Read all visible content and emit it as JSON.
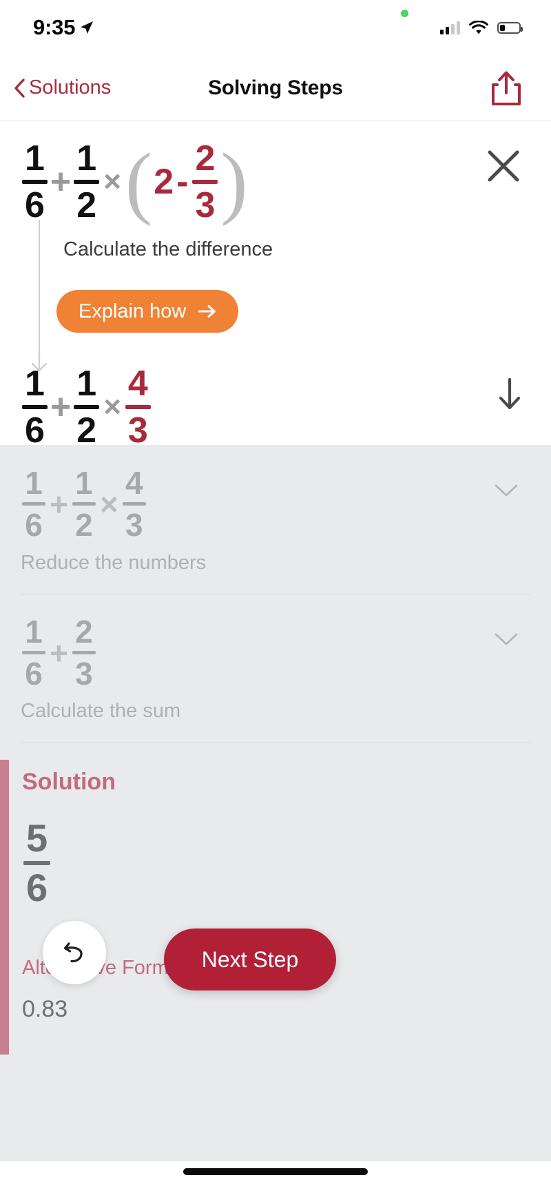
{
  "statusbar": {
    "time": "9:35",
    "location_icon": "location-arrow-icon",
    "cellular_icon": "cellular-signal-icon",
    "cellular_bars_filled": 2,
    "wifi_icon": "wifi-icon",
    "battery_icon": "battery-icon",
    "battery_percent": 25,
    "recording_dot": "green-privacy-dot"
  },
  "navbar": {
    "back_label": "Solutions",
    "back_icon": "chevron-left-icon",
    "title": "Solving Steps",
    "share_icon": "share-icon"
  },
  "active_step": {
    "close_icon": "close-icon",
    "down_icon": "arrow-down-icon",
    "guide_arrow_icon": "arrow-down-guide-icon",
    "hint": "Calculate the difference",
    "explain_label": "Explain how",
    "explain_arrow_icon": "arrow-right-icon",
    "expression": {
      "f1": {
        "num": "1",
        "den": "6"
      },
      "op1": "+",
      "f2": {
        "num": "1",
        "den": "2"
      },
      "op2": "×",
      "paren_open": "(",
      "whole": "2",
      "op3": "-",
      "f3": {
        "num": "2",
        "den": "3"
      },
      "paren_close": ")"
    },
    "result": {
      "f1": {
        "num": "1",
        "den": "6"
      },
      "op1": "+",
      "f2": {
        "num": "1",
        "den": "2"
      },
      "op2": "×",
      "f3": {
        "num": "4",
        "den": "3"
      }
    }
  },
  "dimmed_steps": [
    {
      "expression": {
        "f1": {
          "num": "1",
          "den": "6"
        },
        "op1": "+",
        "f2": {
          "num": "1",
          "den": "2"
        },
        "op2": "×",
        "f3": {
          "num": "4",
          "den": "3"
        }
      },
      "label": "Reduce the numbers",
      "chevron_icon": "chevron-down-icon"
    },
    {
      "expression": {
        "f1": {
          "num": "1",
          "den": "6"
        },
        "op1": "+",
        "f2": {
          "num": "2",
          "den": "3"
        }
      },
      "label": "Calculate the sum",
      "chevron_icon": "chevron-down-icon"
    }
  ],
  "solution": {
    "title": "Solution",
    "fraction": {
      "num": "5",
      "den": "6"
    },
    "alt_form_label": "Alternative Form",
    "alt_form_value": "0.83"
  },
  "controls": {
    "undo_label": "",
    "undo_icon": "undo-icon",
    "next_label": "Next Step"
  },
  "colors": {
    "brand_red": "#a82b3d",
    "next_button_red": "#b22038",
    "explain_orange": "#ef8234",
    "solution_pink": "#c26b80",
    "accent_bar": "#c97f91",
    "dimmed_bg": "#e9eaec",
    "dimmed_text": "#b0b0b0"
  }
}
